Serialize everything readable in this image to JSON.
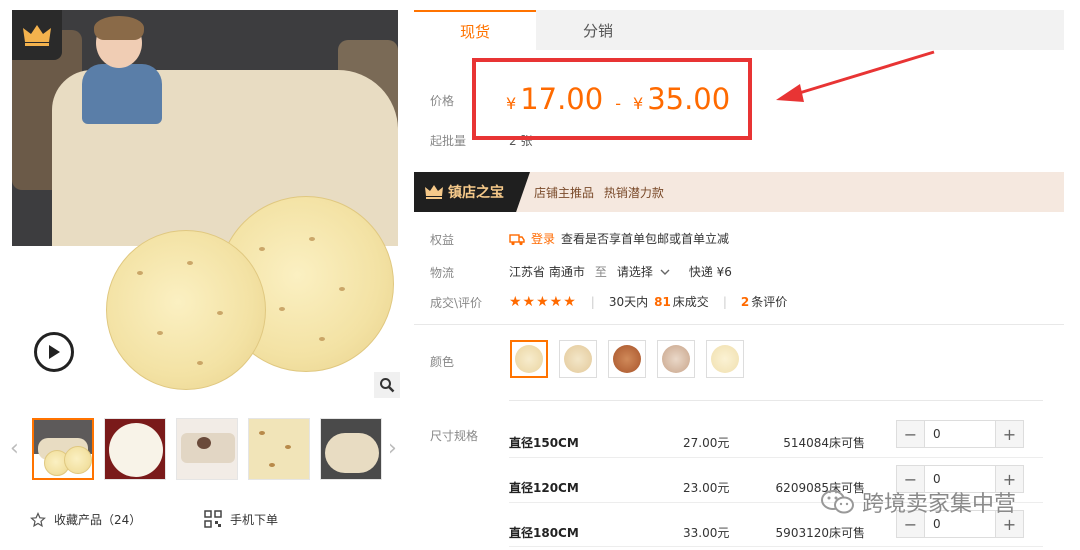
{
  "tabs": [
    {
      "label": "现货"
    },
    {
      "label": "分销"
    }
  ],
  "price": {
    "label": "价格",
    "currency": "¥",
    "low": "17.00",
    "dash": "-",
    "high": "35.00"
  },
  "moq": {
    "label": "起批量",
    "value": "2 张"
  },
  "banner": {
    "title": "镇店之宝",
    "tags": "店铺主推品 热销潜力款"
  },
  "rights": {
    "label": "权益",
    "login_link": "登录",
    "text": "查看是否享首单包邮或首单立减"
  },
  "logistics": {
    "label": "物流",
    "from": "江苏省 南通市",
    "to_word": "至",
    "select": "请选择",
    "express": "快递 ¥6"
  },
  "deals": {
    "label": "成交\\评价",
    "stars": "★★★★★",
    "sold_prefix": "30天内",
    "sold_count": "81",
    "sold_suffix": "床成交",
    "review_count": "2",
    "review_suffix": "条评价"
  },
  "color": {
    "label": "颜色"
  },
  "size": {
    "label": "尺寸规格"
  },
  "skus": [
    {
      "name": "直径150CM",
      "price": "27.00元",
      "stock": "514084床可售",
      "qty": "0"
    },
    {
      "name": "直径120CM",
      "price": "23.00元",
      "stock": "6209085床可售",
      "qty": "0"
    },
    {
      "name": "直径180CM",
      "price": "33.00元",
      "stock": "5903120床可售",
      "qty": "0"
    }
  ],
  "stepper": {
    "minus": "−",
    "plus": "+"
  },
  "left": {
    "favorite": "收藏产品（24）",
    "mobile_order": "手机下单"
  },
  "watermark": "跨境卖家集中营",
  "colors": {
    "accent": "#ff6a00",
    "highlight_box": "#e83434",
    "tab_active": "#ff7300"
  }
}
